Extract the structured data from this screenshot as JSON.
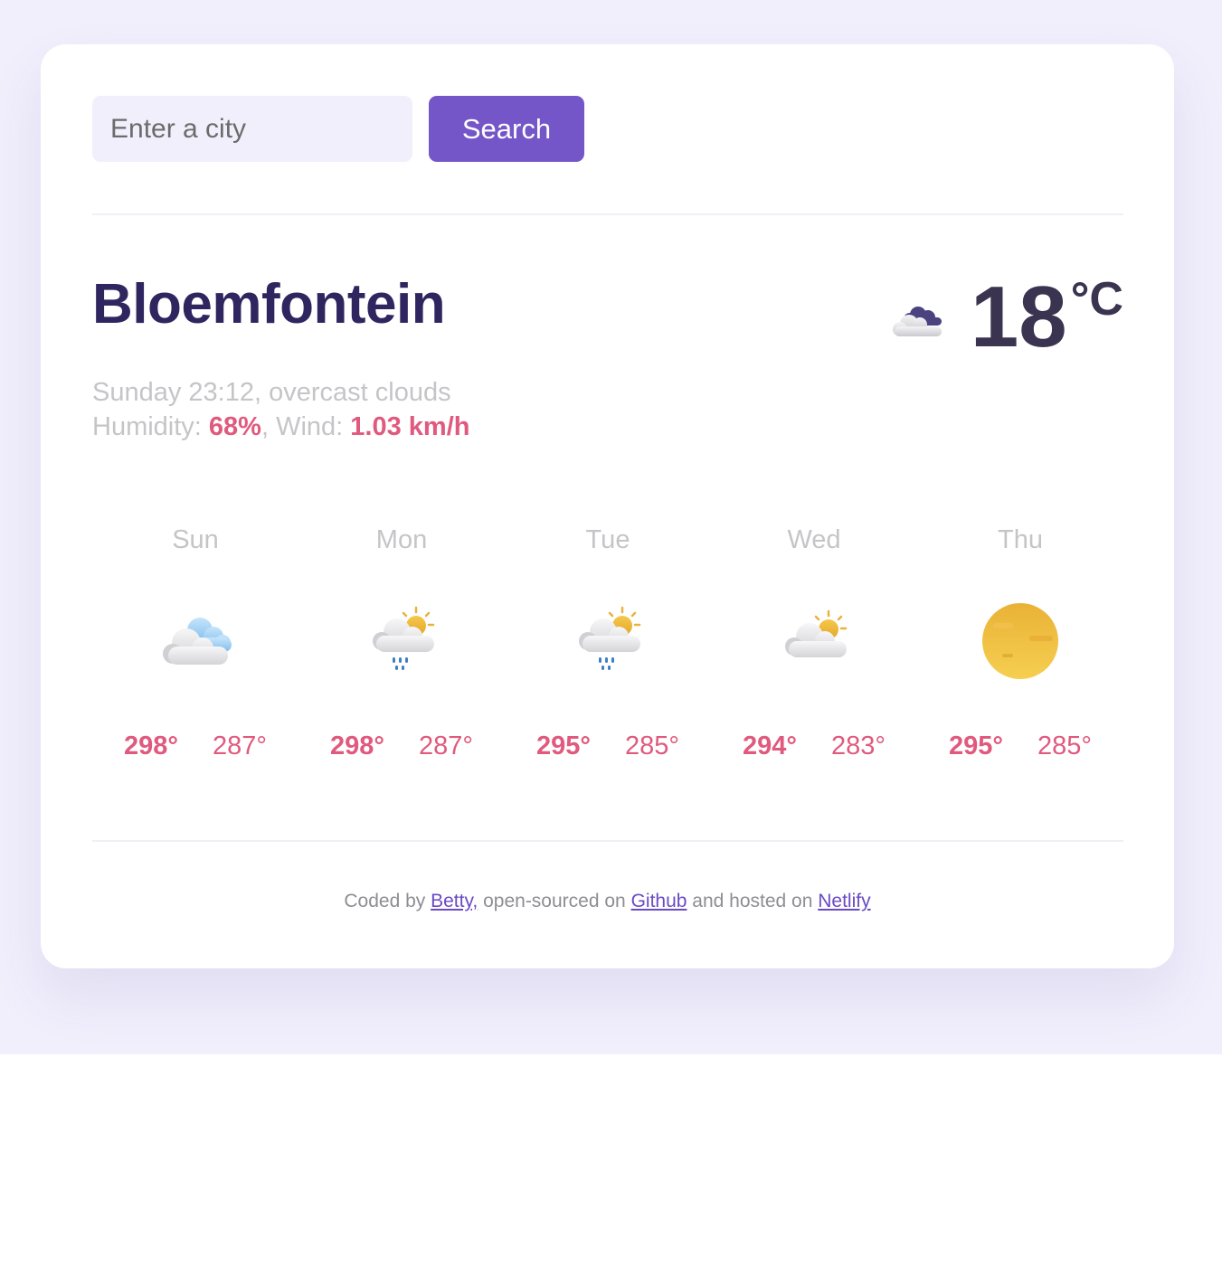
{
  "search": {
    "placeholder": "Enter a city",
    "value": "",
    "button_label": "Search"
  },
  "current": {
    "city": "Bloemfontein",
    "datetime": "Sunday 23:12",
    "description": "overcast clouds",
    "humidity_label": "Humidity: ",
    "humidity_value": "68%",
    "wind_label": ", Wind: ",
    "wind_value": "1.03 km/h",
    "temperature": "18",
    "unit": "°C",
    "icon": "overcast-clouds-icon"
  },
  "forecast": [
    {
      "day": "Sun",
      "icon": "broken-clouds-icon",
      "max": "298°",
      "min": "287°"
    },
    {
      "day": "Mon",
      "icon": "sun-rain-icon",
      "max": "298°",
      "min": "287°"
    },
    {
      "day": "Tue",
      "icon": "sun-rain-icon",
      "max": "295°",
      "min": "285°"
    },
    {
      "day": "Wed",
      "icon": "partly-cloudy-icon",
      "max": "294°",
      "min": "283°"
    },
    {
      "day": "Thu",
      "icon": "hazy-sun-icon",
      "max": "295°",
      "min": "285°"
    }
  ],
  "footer": {
    "prefix": "Coded by ",
    "author": "Betty,",
    "middle": " open-sourced on ",
    "github": "Github",
    "hosted": " and hosted on ",
    "netlify": "Netlify"
  },
  "colors": {
    "accent": "#7456c8",
    "highlight": "#e05a7e",
    "title": "#2f2660",
    "background": "#f1effc"
  }
}
